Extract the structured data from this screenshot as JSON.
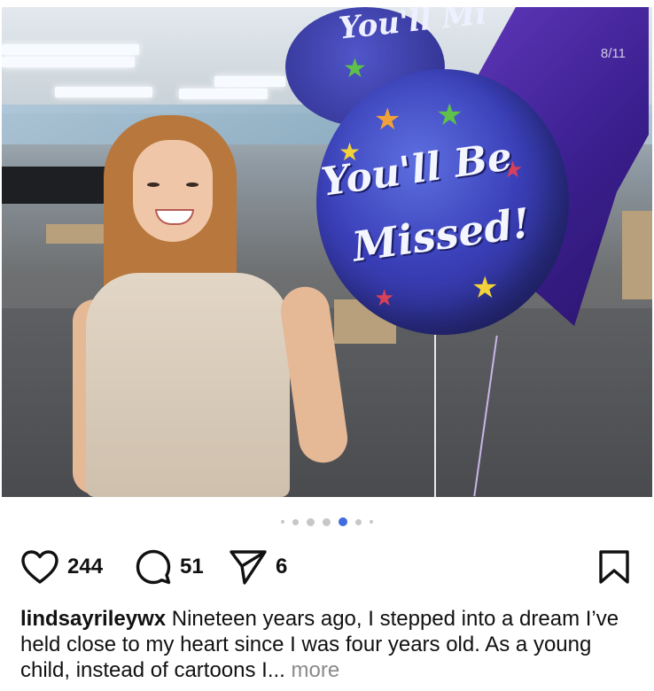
{
  "post": {
    "image": {
      "page_counter": "8/11",
      "balloon_text_line1": "You'll Be",
      "balloon_text_line2": "Missed!",
      "balloon_top_text": "You'll Mi"
    },
    "carousel": {
      "total_dots_visible": 7,
      "active_index": 4
    },
    "actions": {
      "like_count": "244",
      "comment_count": "51",
      "share_count": "6"
    },
    "caption": {
      "username": "lindsayrileywx",
      "text": "Nineteen years ago, I stepped into a dream I’ve held close to my heart since I was four years old. As a young child, instead of cartoons I...",
      "more_label": "more"
    }
  },
  "icons": {
    "like": "heart-icon",
    "comment": "comment-bubble-icon",
    "share": "paper-plane-icon",
    "save": "bookmark-icon"
  },
  "colors": {
    "active_dot": "#3f6cdf",
    "inactive_dot": "#c7c7c7",
    "more_text": "#8a8a8a"
  }
}
